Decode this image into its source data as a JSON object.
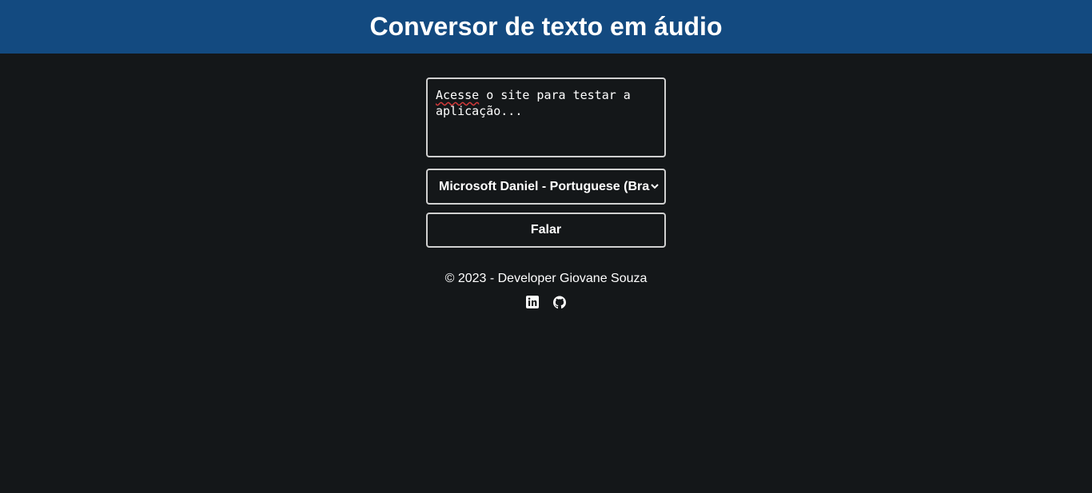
{
  "header": {
    "title": "Conversor de texto em áudio"
  },
  "form": {
    "text_first_word": "Acesse",
    "text_rest": " o site para testar a\naplicação...",
    "voice_selected": "Microsoft Daniel - Portuguese (Brazil)",
    "speak_label": "Falar"
  },
  "footer": {
    "copyright": "© 2023 - Developer Giovane Souza",
    "links": [
      {
        "icon": "linkedin-icon"
      },
      {
        "icon": "github-icon"
      }
    ]
  },
  "colors": {
    "header_bg": "#134a80",
    "page_bg": "#141719",
    "border": "#d0d0d0",
    "text": "#ffffff"
  }
}
